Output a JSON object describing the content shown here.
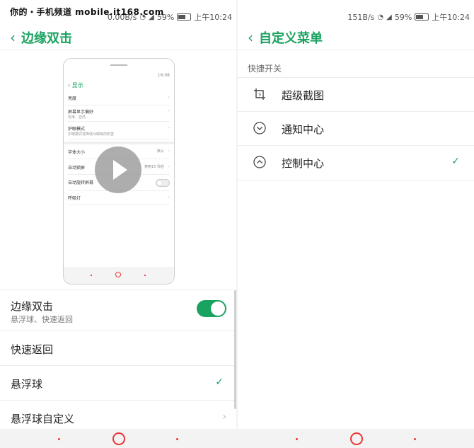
{
  "watermark": "你的・手机频道 mobile.it168.com",
  "left": {
    "status": {
      "speed": "0.00B/s",
      "battery": "59%",
      "time": "上午10:24"
    },
    "title": "边缘双击",
    "preview": {
      "status_time": "16:08",
      "back_label": "显示",
      "rows": [
        {
          "label": "亮度",
          "sub": "",
          "value": ""
        },
        {
          "label": "屏幕显示偏好",
          "sub": "标准、自然",
          "value": ""
        },
        {
          "label": "护眼模式",
          "sub": "护眼模式将降低对眼睛的伤害",
          "value": ""
        },
        {
          "label": "字体大小",
          "sub": "",
          "value": "默认"
        },
        {
          "label": "自动锁屏",
          "sub": "",
          "value": "使用15 秒后"
        },
        {
          "label": "自动旋转屏幕",
          "sub": "",
          "value": ""
        },
        {
          "label": "呼吸灯",
          "sub": "",
          "value": ""
        }
      ]
    },
    "settings": [
      {
        "label": "边缘双击",
        "sub": "悬浮球、快速返回",
        "control": "toggle-on"
      },
      {
        "label": "快速返回",
        "control": "none"
      },
      {
        "label": "悬浮球",
        "control": "check"
      },
      {
        "label": "悬浮球自定义",
        "control": "chevron"
      }
    ]
  },
  "right": {
    "status": {
      "speed": "151B/s",
      "battery": "59%",
      "time": "上午10:24"
    },
    "title": "自定义菜单",
    "section_title": "快捷开关",
    "items": [
      {
        "label": "超级截图",
        "icon": "screenshot-crop-icon",
        "checked": false
      },
      {
        "label": "通知中心",
        "icon": "chevron-down-circle-icon",
        "checked": false
      },
      {
        "label": "控制中心",
        "icon": "chevron-up-circle-icon",
        "checked": true
      }
    ]
  },
  "colors": {
    "accent": "#1aa260",
    "nav_red": "#e33333"
  }
}
